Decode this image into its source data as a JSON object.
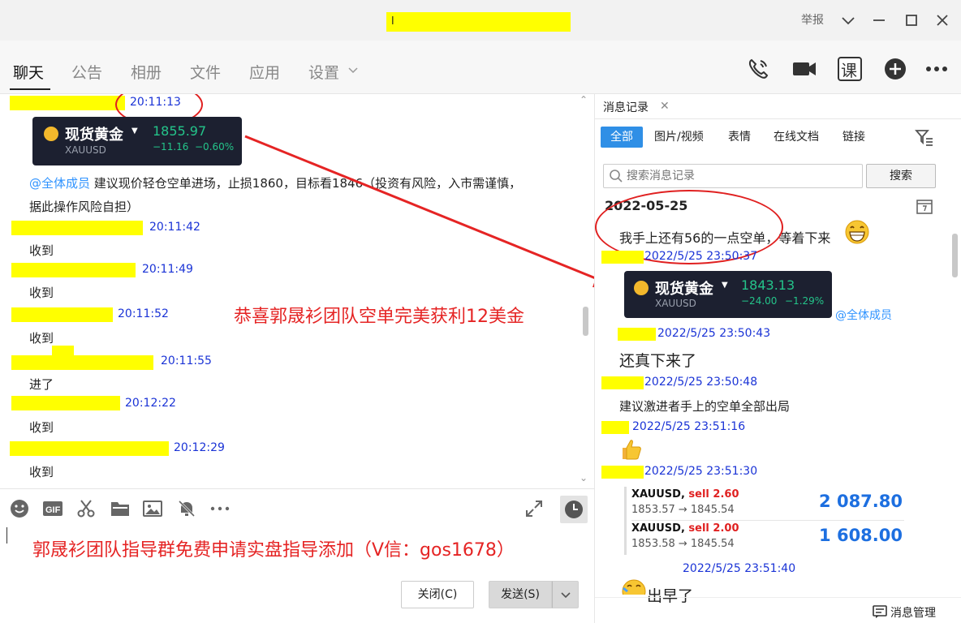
{
  "window": {
    "title": "l",
    "report_label": "举报"
  },
  "tabs": [
    {
      "label": "聊天"
    },
    {
      "label": "公告"
    },
    {
      "label": "相册"
    },
    {
      "label": "文件"
    },
    {
      "label": "应用"
    },
    {
      "label": "设置"
    }
  ],
  "toolbar_icons": [
    "phone-icon",
    "video-call-icon",
    "class-icon",
    "add-icon",
    "more-icon"
  ],
  "toolbar_class_label": "课",
  "chat": {
    "messages": [
      {
        "time": "20:11:13"
      },
      {
        "time": "20:11:42",
        "text": "收到"
      },
      {
        "time": "20:11:49",
        "text": "收到"
      },
      {
        "time": "20:11:52",
        "text": "收到"
      },
      {
        "time": "20:11:55",
        "text": "进了"
      },
      {
        "time": "20:12:22",
        "text": "收到"
      },
      {
        "time": "20:12:29",
        "text": "收到"
      }
    ],
    "stock_card": {
      "name": "现货黄金",
      "code": "XAUUSD",
      "price": "1855.97",
      "change": "−11.16",
      "change_pct": "−0.60%"
    },
    "mention": "@全体成员",
    "announcement": "建议现价轻仓空单进场，止损1860，目标看1846（投资有风险，入市需谨慎，",
    "announcement_line2": "据此操作风险自担）",
    "overlay_text": "恭喜郭晟衫团队空单完美获利12美金"
  },
  "compose": {
    "text": "郭晟衫团队指导群免费申请实盘指导添加（V信：gos1678）",
    "close_label": "关闭(C)",
    "send_label": "发送(S)"
  },
  "history": {
    "tab_label": "消息记录",
    "filters": [
      "全部",
      "图片/视频",
      "表情",
      "在线文档",
      "链接"
    ],
    "search_placeholder": "搜索消息记录",
    "search_button": "搜索",
    "date": "2022-05-25",
    "msg1": "我手上还有56的一点空单，等着下来",
    "time1": "2022/5/25 23:50:37",
    "stock_card": {
      "name": "现货黄金",
      "code": "XAUUSD",
      "price": "1843.13",
      "change": "−24.00",
      "change_pct": "−1.29%"
    },
    "mention": "@全体成员",
    "time2": "2022/5/25 23:50:43",
    "msg2": "还真下来了",
    "time3": "2022/5/25 23:50:48",
    "msg3": "建议激进者手上的空单全部出局",
    "time4": "2022/5/25 23:51:16",
    "time5": "2022/5/25 23:51:30",
    "trades": [
      {
        "symbol": "XAUUSD,",
        "side": "sell 2.60",
        "prices": "1853.57 → 1845.54",
        "amount": "2 087.80"
      },
      {
        "symbol": "XAUUSD,",
        "side": "sell 2.00",
        "prices": "1853.58 → 1845.54",
        "amount": "1 608.00"
      }
    ],
    "time6": "2022/5/25 23:51:40",
    "msg6": "出早了",
    "manage_label": "消息管理"
  }
}
